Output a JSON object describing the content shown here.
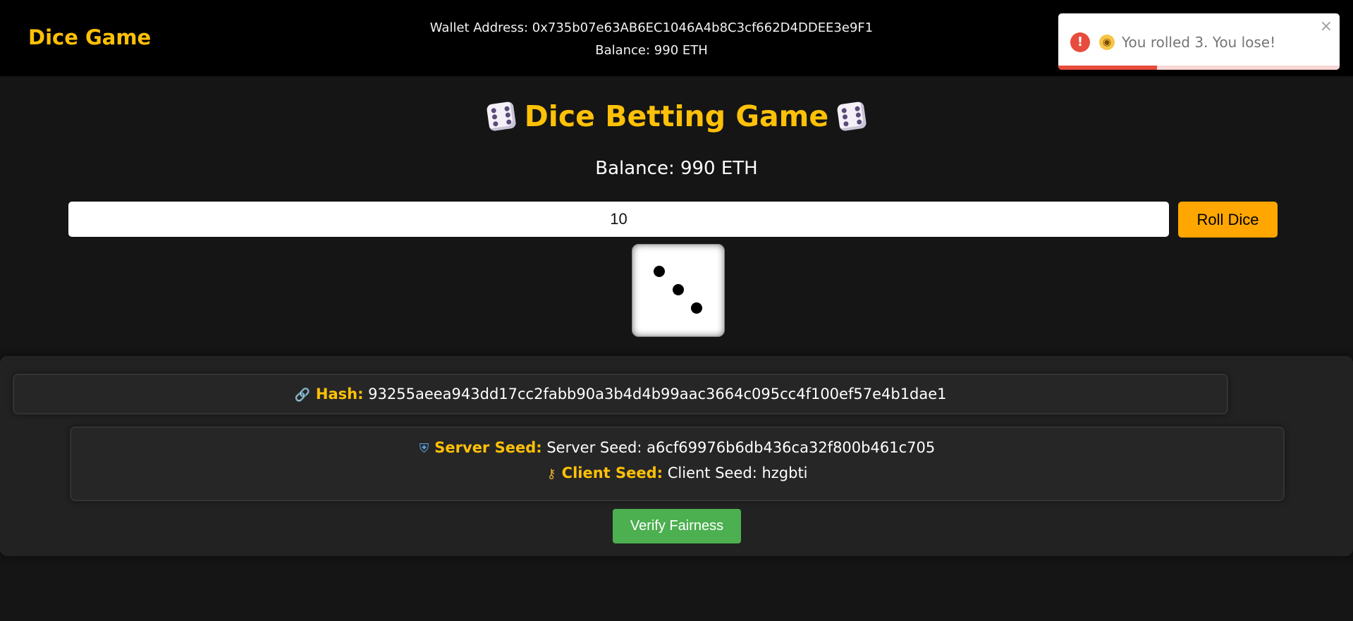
{
  "header": {
    "brand": "Dice Game",
    "wallet_label": "Wallet Address: 0x735b07e63AB6EC1046A4b8C3cf662D4DDEE3e9F1",
    "balance_label": "Balance: 990 ETH"
  },
  "toast": {
    "icon": "!",
    "emoji": "😳",
    "message": "You rolled 3. You lose!",
    "close": "×",
    "progress_remaining": 0.35,
    "colors": {
      "error": "#e74c3c"
    }
  },
  "main": {
    "title": "Dice Betting Game",
    "balance": "Balance: 990 ETH",
    "bet_value": "10",
    "roll_button": "Roll Dice",
    "dice_value": 3
  },
  "fairness": {
    "hash_label": "Hash:",
    "hash_value": "93255aeea943dd17cc2fabb90a3b4d4b99aac3664c095cc4f100ef57e4b1dae1",
    "server_seed_label": "Server Seed:",
    "server_seed_value": "Server Seed: a6cf69976b6db436ca32f800b461c705",
    "client_seed_label": "Client Seed:",
    "client_seed_value": "Client Seed: hzgbti",
    "verify_button": "Verify Fairness",
    "icons": {
      "hash": "link-icon",
      "server": "shield-icon",
      "client": "key-icon"
    }
  },
  "colors": {
    "accent": "#ffc107",
    "roll_button": "#ffa600",
    "verify_button": "#4caf50"
  }
}
